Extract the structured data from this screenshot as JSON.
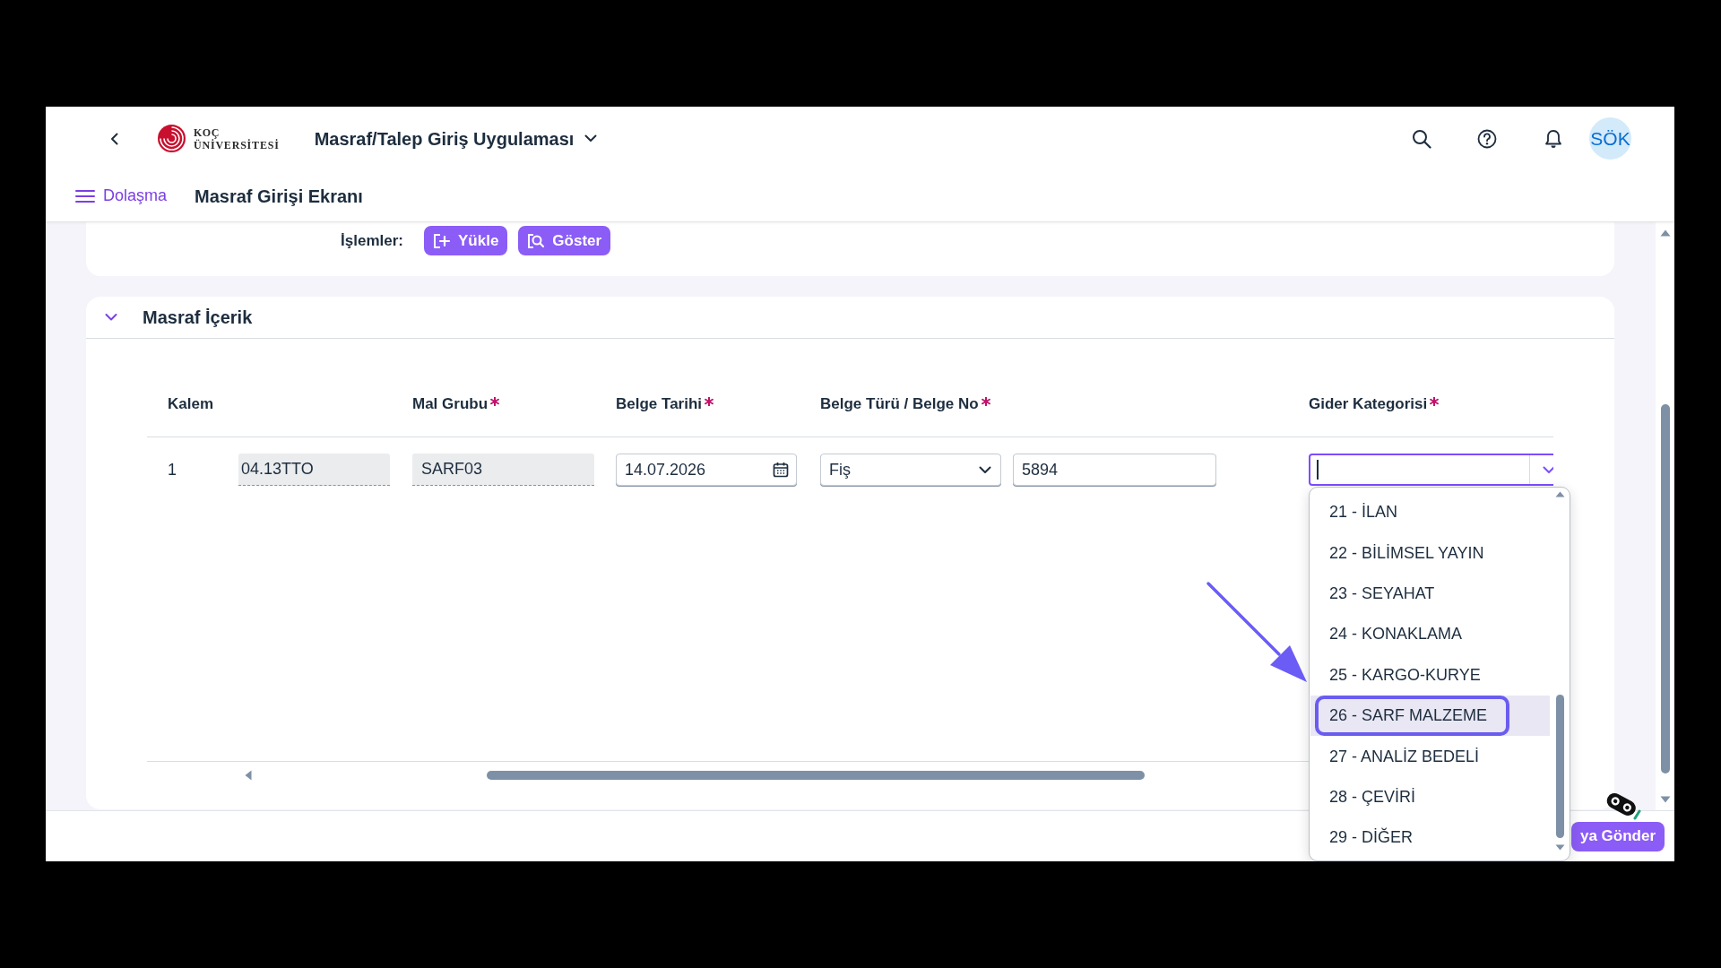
{
  "header": {
    "logo": {
      "line_1": "KOÇ",
      "line_2": "ÜNİVERSİTESİ"
    },
    "app_title": "Masraf/Talep Giriş Uygulaması",
    "avatar": "SÖK"
  },
  "subheader": {
    "navigation": "Dolaşma",
    "page_title": "Masraf Girişi Ekranı"
  },
  "actions_card": {
    "label": "İşlemler:",
    "buttons": [
      {
        "label": "Yükle",
        "kind": "upload"
      },
      {
        "label": "Göster",
        "kind": "view"
      }
    ]
  },
  "content_card": {
    "title": "Masraf İçerik",
    "expanded": true,
    "table": {
      "columns": [
        {
          "label": "Kalem",
          "required": false
        },
        {
          "label": "Mal Grubu",
          "required": true
        },
        {
          "label": "Belge Tarihi",
          "required": true
        },
        {
          "label": "Belge Türü / Belge No",
          "required": true
        },
        {
          "label": "Gider Kategorisi",
          "required": true
        }
      ],
      "rows": [
        {
          "cells": [
            {
              "kind": "item",
              "number": "1",
              "code": "04.13TTO"
            },
            {
              "kind": "readonly",
              "value": "SARF03"
            },
            {
              "kind": "date",
              "value": "14.07.2026"
            },
            {
              "kind": "document",
              "type": "Fiş",
              "number": "5894"
            },
            {
              "kind": "combo",
              "focused": true,
              "options": [
                {
                  "label": "21 - İLAN",
                  "selected": false,
                  "annotated": false
                },
                {
                  "label": "22 - BİLİMSEL YAYIN",
                  "selected": false,
                  "annotated": false
                },
                {
                  "label": "23 - SEYAHAT",
                  "selected": false,
                  "annotated": false
                },
                {
                  "label": "24 - KONAKLAMA",
                  "selected": false,
                  "annotated": false
                },
                {
                  "label": "25 - KARGO-KURYE",
                  "selected": false,
                  "annotated": false
                },
                {
                  "label": "26 - SARF MALZEME",
                  "selected": true,
                  "annotated": true
                },
                {
                  "label": "27 - ANALİZ BEDELİ",
                  "selected": false,
                  "annotated": false
                },
                {
                  "label": "28 - ÇEVİRİ",
                  "selected": false,
                  "annotated": false
                },
                {
                  "label": "29 - DİĞER",
                  "selected": false,
                  "annotated": false
                }
              ]
            }
          ]
        }
      ]
    }
  },
  "footer": {
    "buttons": [
      {
        "label": "ya Gönder"
      }
    ]
  }
}
